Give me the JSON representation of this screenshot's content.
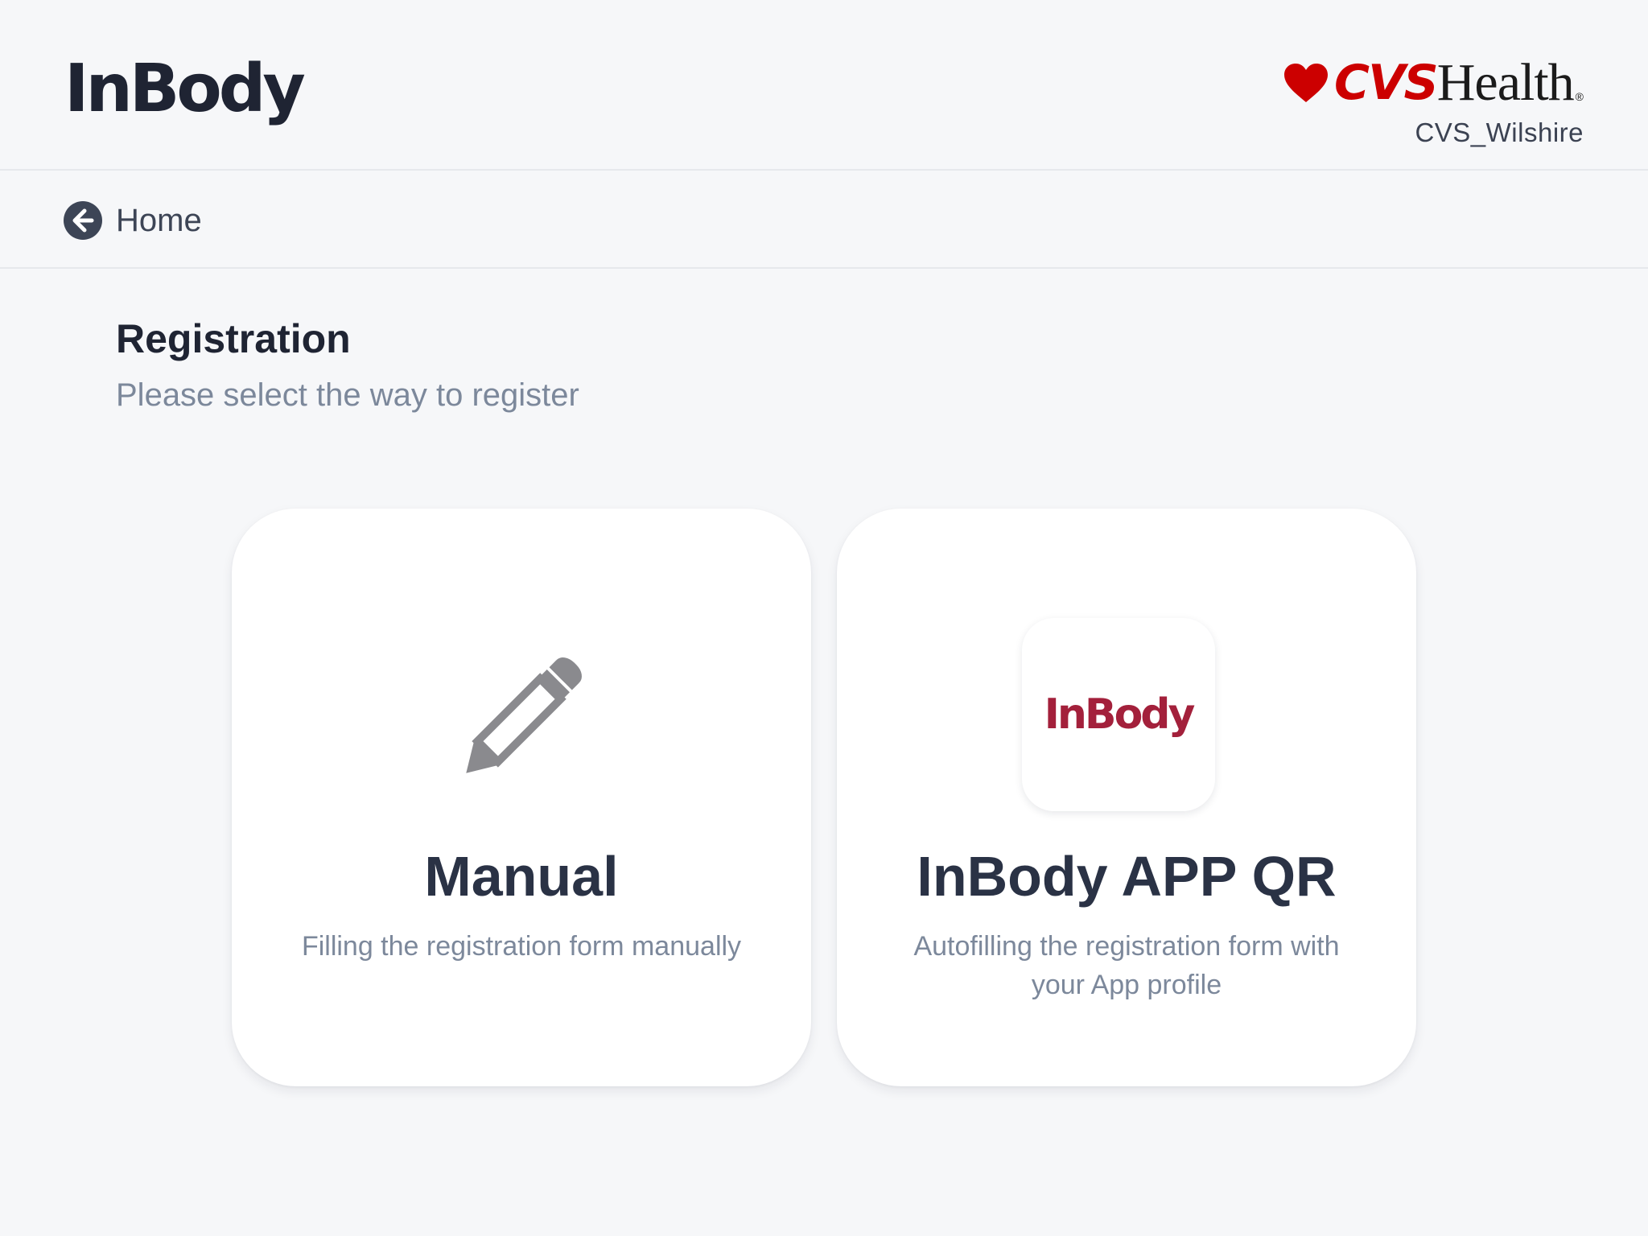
{
  "header": {
    "brand_logo_text": "InBody",
    "partner_logo": {
      "mark": "CVS",
      "wordmark": "Health",
      "reg": "®",
      "brand_color": "#cc0000"
    },
    "store_name": "CVS_Wilshire"
  },
  "nav": {
    "back_label": "Home",
    "back_icon": "arrow-left-circle-icon"
  },
  "page": {
    "title": "Registration",
    "subtitle": "Please select the way to register"
  },
  "options": {
    "manual": {
      "icon": "pencil-icon",
      "title": "Manual",
      "description": "Filling the registration form manually"
    },
    "qr": {
      "icon_text": "InBody",
      "icon_color": "#a3203b",
      "title": "InBody APP QR",
      "description": "Autofilling the registration form with your App profile"
    }
  }
}
